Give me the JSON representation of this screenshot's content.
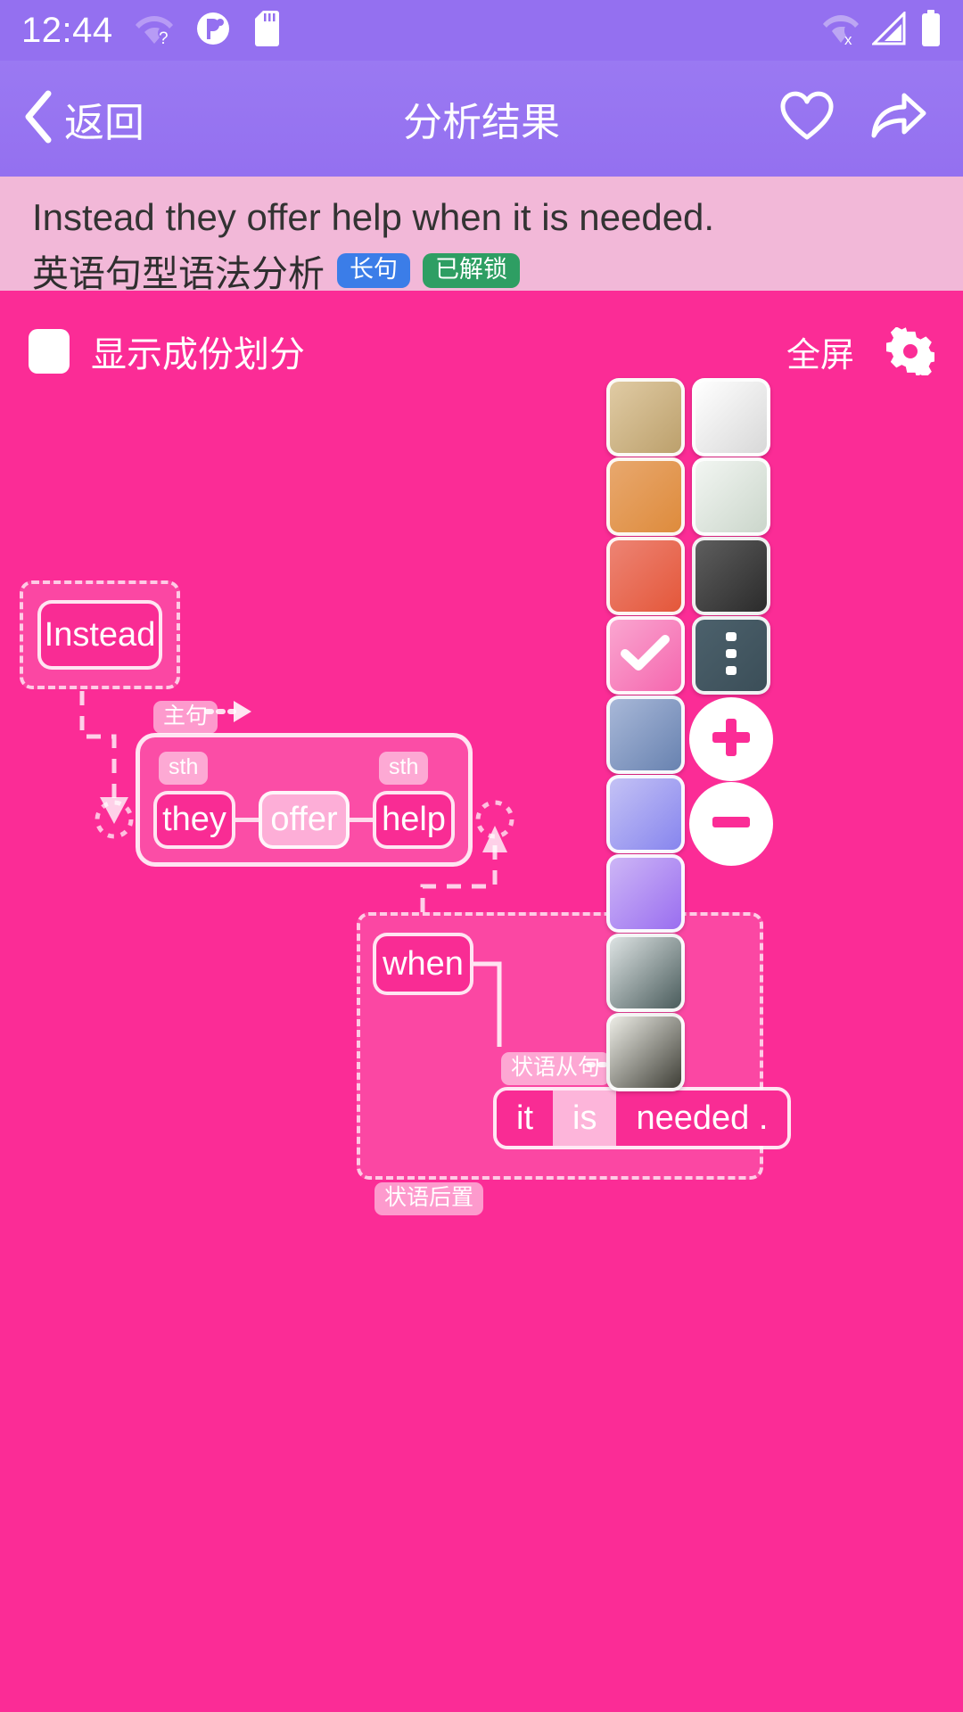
{
  "statusbar": {
    "clock": "12:44",
    "left_icons": [
      "wifi-question-icon",
      "app-badge-icon",
      "sd-card-icon"
    ],
    "right_icons": [
      "wifi-off-icon",
      "signal-icon",
      "battery-icon"
    ]
  },
  "appbar": {
    "back_label": "返回",
    "title": "分析结果",
    "actions": [
      "heart-icon",
      "share-icon"
    ]
  },
  "header": {
    "sentence": "Instead they offer help when it is needed.",
    "subtitle": "英语句型语法分析",
    "badges": [
      {
        "label": "长句",
        "color": "#3B7DE8"
      },
      {
        "label": "已解锁",
        "color": "#2E9E63"
      }
    ]
  },
  "toolbar": {
    "checkbox_label": "显示成份划分",
    "checkbox_checked": false,
    "fullscreen_label": "全屏",
    "gear_icon": "gear-icon"
  },
  "swatches": [
    {
      "name": "swatch-tan",
      "from": "#E0CBA4",
      "to": "#BCA06C",
      "selected": false
    },
    {
      "name": "swatch-white",
      "from": "#FFFFFF",
      "to": "#D8D8D8",
      "selected": false
    },
    {
      "name": "swatch-orange",
      "from": "#E8A86E",
      "to": "#DE8B3C",
      "selected": false
    },
    {
      "name": "swatch-pale-green",
      "from": "#F2F6F2",
      "to": "#CBD6CB",
      "selected": false
    },
    {
      "name": "swatch-salmon",
      "from": "#ED8474",
      "to": "#E4573A",
      "selected": false
    },
    {
      "name": "swatch-charcoal",
      "from": "#5E5E5E",
      "to": "#2B2B2B",
      "selected": false
    },
    {
      "name": "swatch-pink",
      "from": "#FAA6D0",
      "to": "#F566AE",
      "selected": true
    },
    {
      "name": "swatch-more",
      "from": "#4C616C",
      "to": "#3B4E58",
      "selected": false,
      "icon": "more-vertical-icon"
    },
    {
      "name": "swatch-steel-blue",
      "from": "#A8B8D8",
      "to": "#6882B0",
      "selected": false
    },
    {
      "name": "swatch-periwinkle",
      "from": "#C4C2F5",
      "to": "#8785EE",
      "selected": false
    },
    {
      "name": "swatch-violet",
      "from": "#CDB6F6",
      "to": "#9A6EF0",
      "selected": false
    },
    {
      "name": "swatch-slate",
      "from": "#DDE3E3",
      "to": "#4A5C5C",
      "selected": false
    },
    {
      "name": "swatch-olive-gray",
      "from": "#EDEDE6",
      "to": "#3E3E36",
      "selected": false
    }
  ],
  "zoom_controls": [
    {
      "name": "zoom-in-button",
      "icon": "plus-icon"
    },
    {
      "name": "zoom-out-button",
      "icon": "minus-icon"
    }
  ],
  "diagram": {
    "nodes": {
      "instead": "Instead",
      "they": "they",
      "offer": "offer",
      "help": "help",
      "when": "when",
      "it": "it",
      "is": "is",
      "needed": "needed ."
    },
    "tags": {
      "main_clause": "主句",
      "sth_subject": "sth",
      "sth_object": "sth",
      "adverbial_clause": "状语从句",
      "adverbial_postposed": "状语后置"
    }
  }
}
